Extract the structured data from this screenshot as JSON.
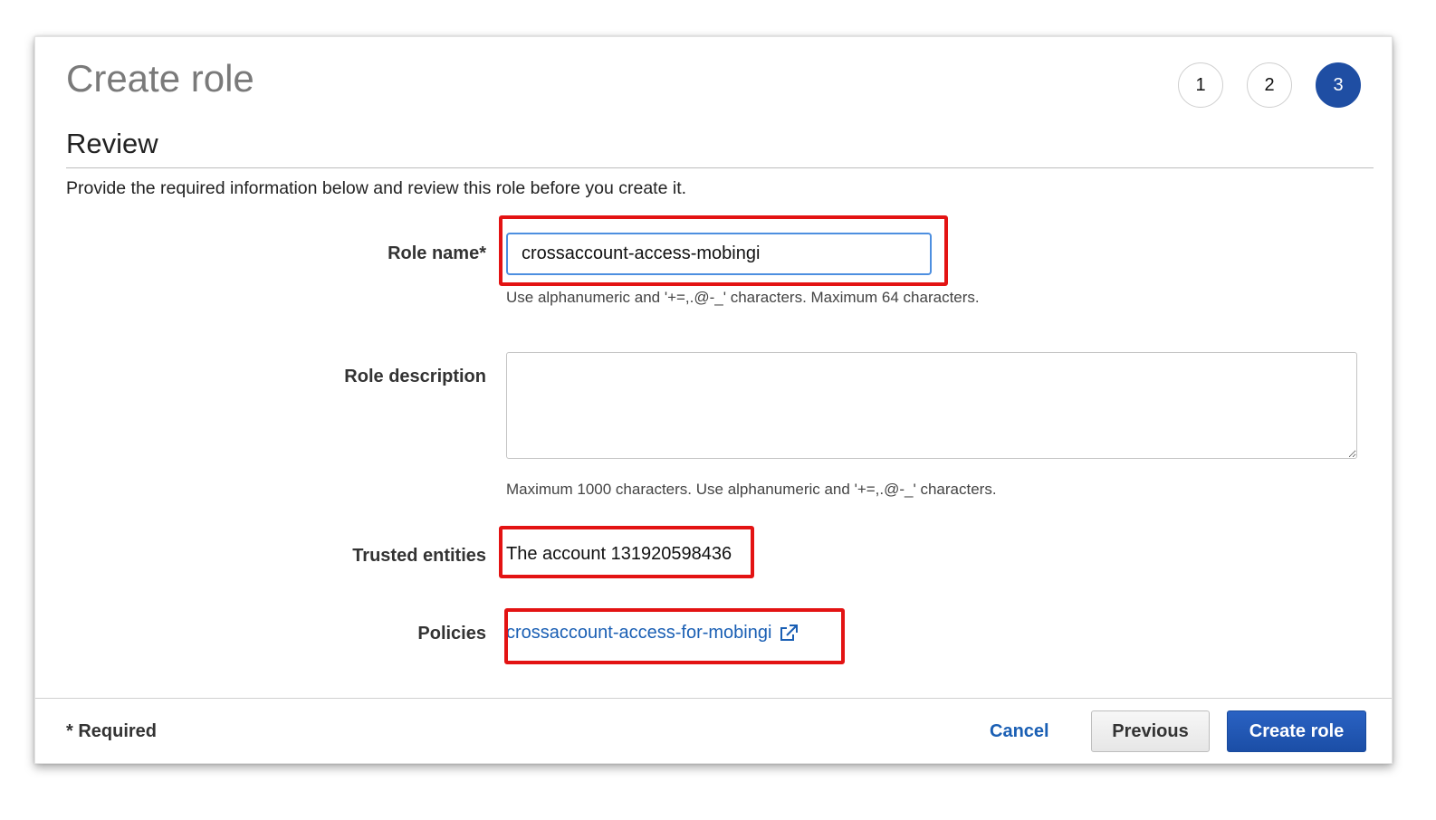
{
  "header": {
    "title": "Create role",
    "steps": [
      "1",
      "2",
      "3"
    ],
    "active_step": "3",
    "active_color": "#1f4ea3"
  },
  "section": {
    "title": "Review",
    "intro": "Provide the required information below and review this role before you create it."
  },
  "form": {
    "role_name": {
      "label": "Role name*",
      "value": "crossaccount-access-mobingi",
      "help": "Use alphanumeric and '+=,.@-_' characters. Maximum 64 characters."
    },
    "role_description": {
      "label": "Role description",
      "value": "",
      "help": "Maximum 1000 characters. Use alphanumeric and '+=,.@-_' characters."
    },
    "trusted_entities": {
      "label": "Trusted entities",
      "value": "The account 131920598436"
    },
    "policies": {
      "label": "Policies",
      "link": "crossaccount-access-for-mobingi",
      "icon": "external-link-icon"
    }
  },
  "footer": {
    "required_note": "* Required",
    "cancel": "Cancel",
    "previous": "Previous",
    "create": "Create role"
  },
  "colors": {
    "highlight": "#e31313",
    "link": "#1a5fb4",
    "primary": "#1b4ea6"
  }
}
